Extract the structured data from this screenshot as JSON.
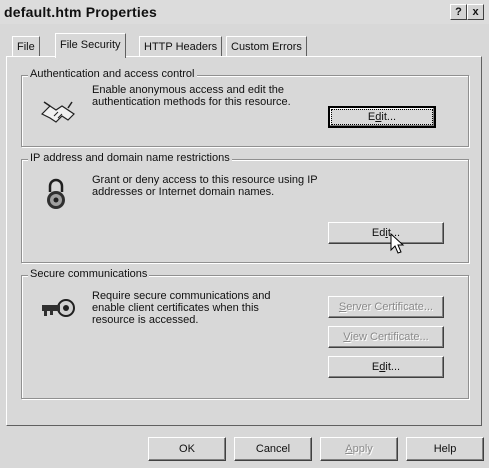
{
  "window": {
    "title": "default.htm Properties",
    "help_button": "?",
    "close_button": "x"
  },
  "tabs": [
    {
      "label": "File"
    },
    {
      "label": "File Security"
    },
    {
      "label": "HTTP Headers"
    },
    {
      "label": "Custom Errors"
    }
  ],
  "auth": {
    "legend": "Authentication and access control",
    "description": "Enable anonymous access and edit the authentication methods for this resource.",
    "edit_pre": "E",
    "edit_u": "d",
    "edit_post": "it..."
  },
  "ip": {
    "legend": "IP address and domain name restrictions",
    "description": "Grant or deny access to this resource using IP addresses or Internet domain names.",
    "edit_pre": "Ed",
    "edit_u": "i",
    "edit_post": "t..."
  },
  "secure": {
    "legend": "Secure communications",
    "description": "Require secure communications and enable client certificates when this resource is accessed.",
    "server_cert_u": "S",
    "server_cert_post": "erver Certificate...",
    "view_cert_u": "V",
    "view_cert_post": "iew Certificate...",
    "edit_pre": "E",
    "edit_u": "d",
    "edit_post": "it..."
  },
  "footer": {
    "ok": "OK",
    "cancel": "Cancel",
    "apply_u": "A",
    "apply_post": "pply",
    "help": "Help"
  }
}
